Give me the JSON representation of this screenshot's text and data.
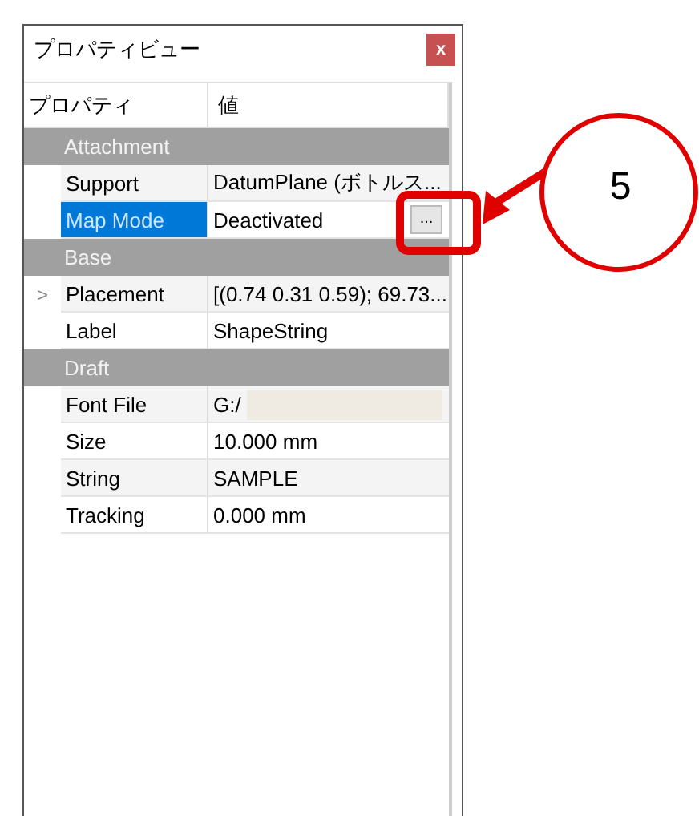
{
  "window": {
    "title": "プロパティビュー",
    "close": "x"
  },
  "columns": [
    "プロパティ",
    "値"
  ],
  "groups": [
    {
      "name": "Attachment",
      "properties": [
        {
          "name": "Support",
          "value": "DatumPlane (ボトルス...",
          "selected": false
        },
        {
          "name": "Map Mode",
          "value": "Deactivated",
          "selected": true,
          "button": "..."
        }
      ]
    },
    {
      "name": "Base",
      "properties": [
        {
          "name": "Placement",
          "value": "[(0.74 0.31 0.59); 69.73...",
          "selected": false,
          "expander": ">",
          "expanded": false
        },
        {
          "name": "Label",
          "value": "ShapeString",
          "selected": false
        }
      ]
    },
    {
      "name": "Draft",
      "properties": [
        {
          "name": "Font File",
          "value": "G:/",
          "selected": false,
          "kind": "file"
        },
        {
          "name": "Size",
          "value": "10.000 mm",
          "selected": false
        },
        {
          "name": "String",
          "value": "SAMPLE",
          "selected": false
        },
        {
          "name": "Tracking",
          "value": "0.000 mm",
          "selected": false
        }
      ]
    }
  ],
  "callout": {
    "number": "5"
  }
}
